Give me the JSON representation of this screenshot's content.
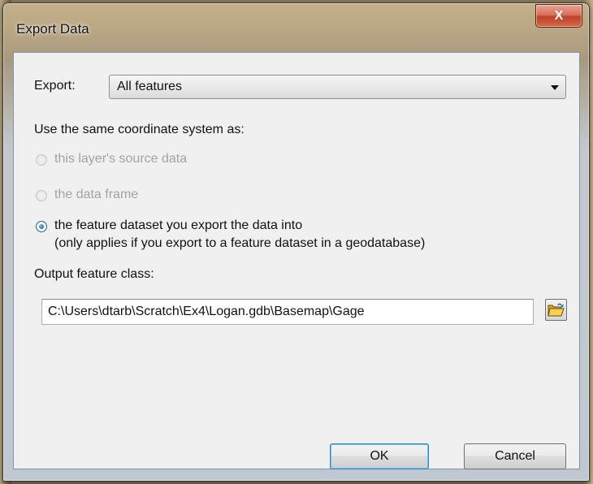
{
  "window": {
    "title": "Export Data",
    "close_glyph": "X"
  },
  "export": {
    "label": "Export:",
    "selected": "All features"
  },
  "coordinate_system": {
    "label": "Use the same coordinate system as:",
    "options": [
      {
        "label": "this layer's source data",
        "enabled": false,
        "selected": false
      },
      {
        "label": "the data frame",
        "enabled": false,
        "selected": false
      },
      {
        "label": "the feature dataset you export the data into",
        "enabled": true,
        "selected": true,
        "note": "(only applies if you export to a feature dataset in a geodatabase)"
      }
    ]
  },
  "output": {
    "label": "Output feature class:",
    "value": "C:\\Users\\dtarb\\Scratch\\Ex4\\Logan.gdb\\Basemap\\Gage",
    "browse_icon": "open-folder-icon"
  },
  "buttons": {
    "ok": "OK",
    "cancel": "Cancel"
  },
  "colors": {
    "accent": "#3c7fb1",
    "close": "#c0422a",
    "disabled_text": "#a3a3a3"
  }
}
